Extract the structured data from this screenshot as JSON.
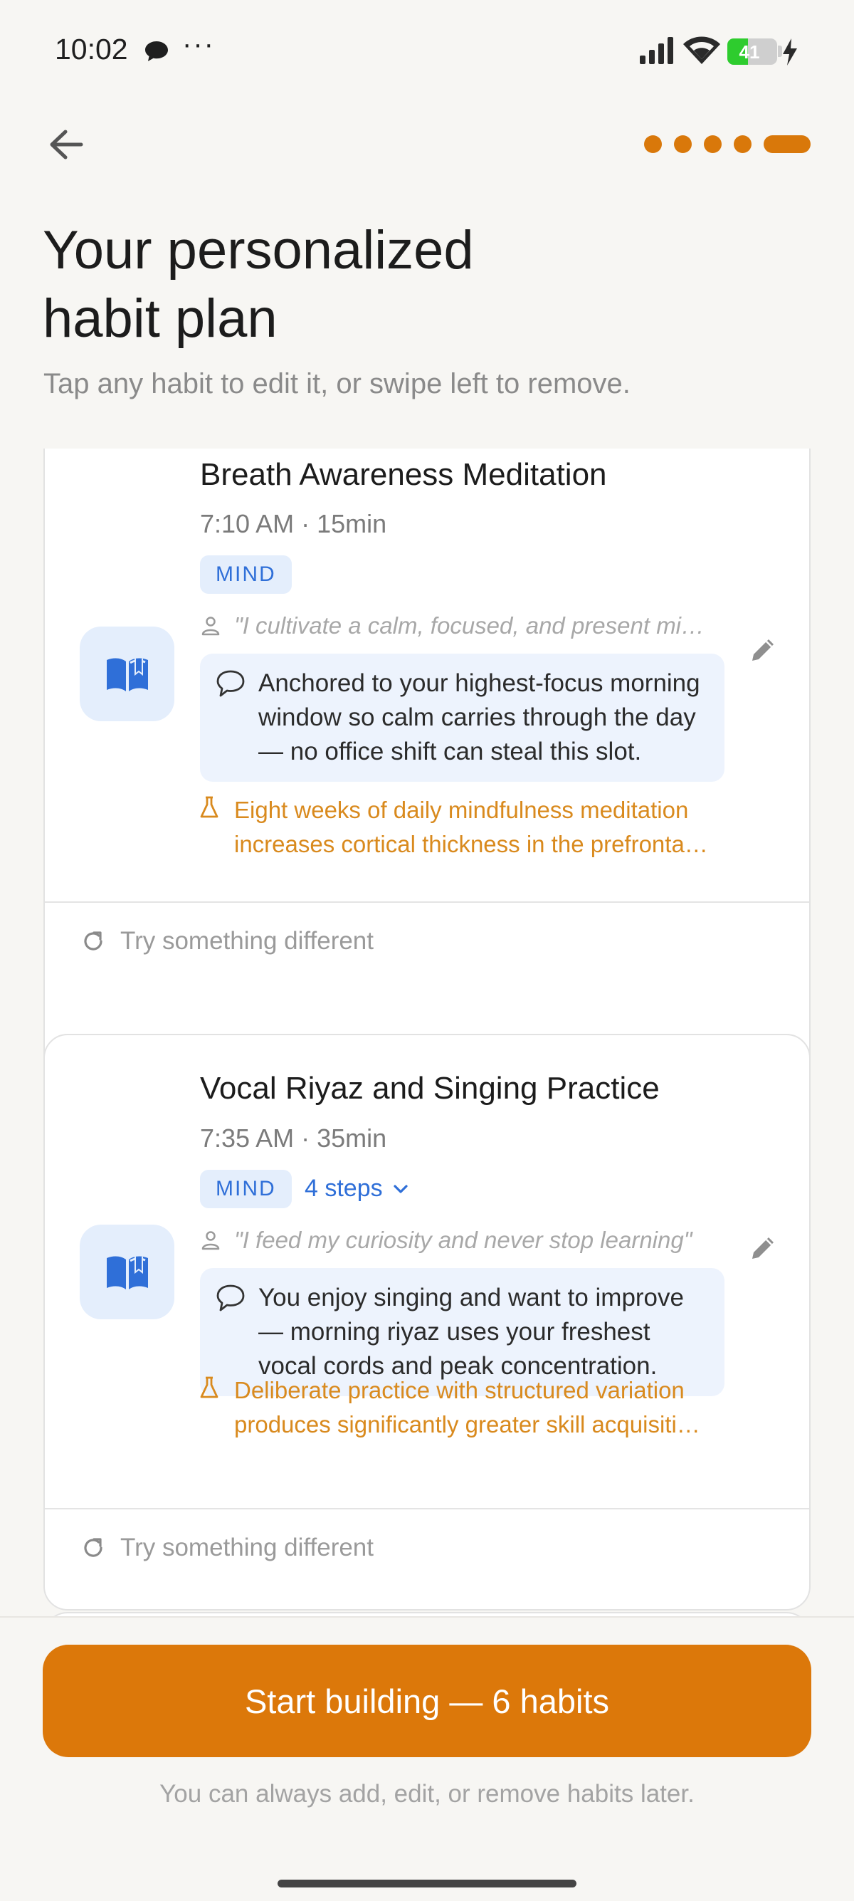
{
  "status_bar": {
    "time": "10:02",
    "overflow": "···",
    "battery_percent": "41",
    "battery_level": 0.41,
    "icons": [
      "chat-bubble-icon",
      "signal-icon",
      "wifi-icon",
      "battery-icon",
      "charging-bolt-icon"
    ]
  },
  "nav": {
    "back_icon": "arrow-left-icon",
    "progress_total": 5,
    "progress_current": 5
  },
  "header": {
    "title_line1": "Your personalized",
    "title_line2": "habit plan",
    "subtitle": "Tap any habit to edit it, or swipe left to remove."
  },
  "habits": [
    {
      "title": "Breath Awareness Meditation",
      "time": "7:10 AM · 15min",
      "tag": "MIND",
      "icon": "open-book-icon",
      "affirmation": "\"I cultivate a calm, focused, and present mi…",
      "reason": "Anchored to your highest-focus morning window so calm carries through the day — no office shift can steal this slot.",
      "science": "Eight weeks of daily mindfulness meditation increases cortical thickness in the prefronta…",
      "try_label": "Try something different"
    },
    {
      "title": "Vocal Riyaz and Singing Practice",
      "time": "7:35 AM · 35min",
      "tag": "MIND",
      "steps": "4 steps",
      "icon": "open-book-icon",
      "affirmation": "\"I feed my curiosity and never stop learning\"",
      "reason": "You enjoy singing and want to improve — morning riyaz uses your freshest vocal cords and peak concentration.",
      "science": "Deliberate practice with structured variation produces significantly greater skill acquisiti…",
      "try_label": "Try something different"
    }
  ],
  "footer": {
    "cta_label": "Start building — 6 habits",
    "note": "You can always add, edit, or remove habits later."
  },
  "colors": {
    "accent": "#dc780a",
    "tag_bg": "#e4eefc",
    "tag_text": "#2f6fd8",
    "science_text": "#d98a1e",
    "background": "#f7f6f3"
  }
}
